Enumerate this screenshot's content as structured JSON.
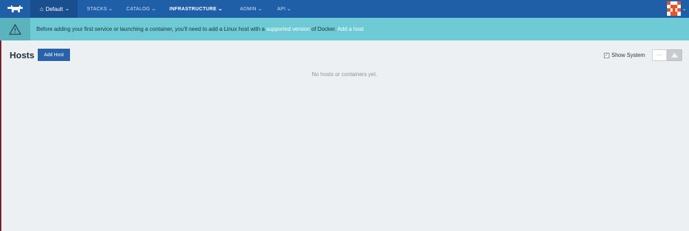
{
  "nav": {
    "environment_label": "Default",
    "items": [
      {
        "label": "STACKS",
        "active": false
      },
      {
        "label": "CATALOG",
        "active": false
      },
      {
        "label": "INFRASTRUCTURE",
        "active": true
      },
      {
        "label": "ADMIN",
        "active": false
      },
      {
        "label": "API",
        "active": false
      }
    ],
    "icons": {
      "logo": "ranch-logo-icon",
      "home": "home-icon",
      "chevron": "chevron-down-icon",
      "avatar": "user-avatar"
    }
  },
  "banner": {
    "text_before": "Before adding your first service or launching a container, you'll need to add a Linux host with a",
    "link_supported": "supported version",
    "text_middle": "of Docker.",
    "link_add_host": "Add a host",
    "icon": "warning-icon"
  },
  "header": {
    "title": "Hosts",
    "add_button_label": "Add Host",
    "show_system_label": "Show System",
    "show_system_checked": true,
    "more_label": "···"
  },
  "main": {
    "empty_message": "No hosts or containers yet."
  },
  "colors": {
    "nav_bg": "#1f5fa8",
    "banner_bg": "#6ecad4",
    "page_bg": "#edf0f2",
    "button_bg": "#2862a8"
  }
}
